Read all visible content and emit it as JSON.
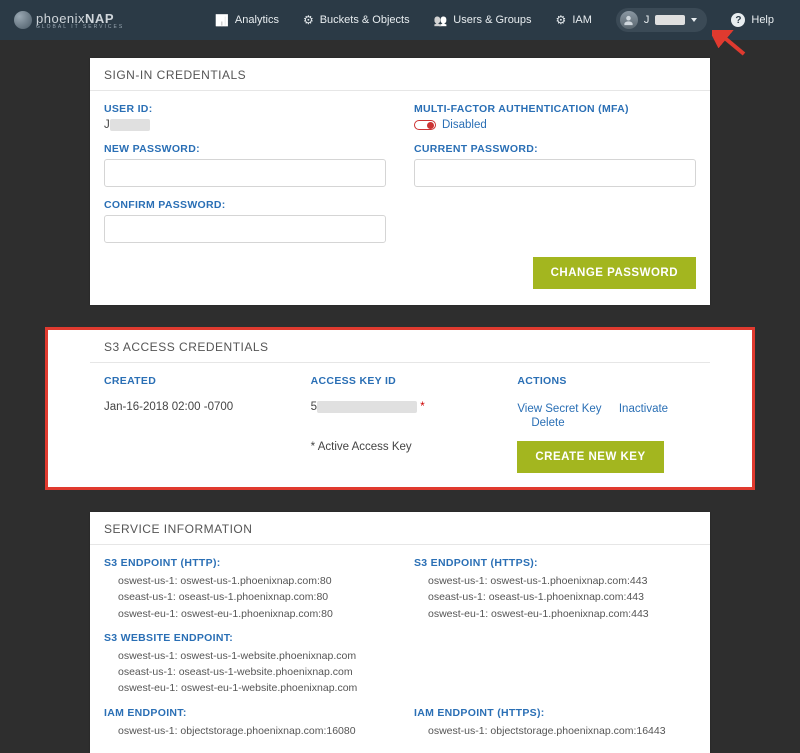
{
  "brand": {
    "name_light": "phoenix",
    "name_bold": "NAP",
    "tagline": "GLOBAL IT SERVICES"
  },
  "nav": {
    "analytics": "Analytics",
    "buckets": "Buckets & Objects",
    "users": "Users & Groups",
    "iam": "IAM",
    "help": "Help",
    "username_initial": "J"
  },
  "signin": {
    "title": "SIGN-IN CREDENTIALS",
    "user_id_label": "USER ID:",
    "user_id_value": "J",
    "mfa_label": "MULTI-FACTOR AUTHENTICATION (MFA)",
    "mfa_status": "Disabled",
    "new_pw_label": "NEW PASSWORD:",
    "current_pw_label": "CURRENT PASSWORD:",
    "confirm_pw_label": "CONFIRM PASSWORD:",
    "change_pw_btn": "CHANGE PASSWORD"
  },
  "s3creds": {
    "title": "S3 ACCESS CREDENTIALS",
    "col_created": "CREATED",
    "col_key": "ACCESS KEY ID",
    "col_actions": "ACTIONS",
    "created_value": "Jan-16-2018 02:00 -0700",
    "key_prefix": "5",
    "key_note": "* Active Access Key",
    "view_secret": "View Secret Key",
    "inactivate": "Inactivate",
    "delete": "Delete",
    "create_btn": "CREATE NEW KEY"
  },
  "svc": {
    "title": "SERVICE INFORMATION",
    "http_label": "S3 ENDPOINT (HTTP):",
    "https_label": "S3 ENDPOINT (HTTPS):",
    "website_label": "S3 WEBSITE ENDPOINT:",
    "iam_label": "IAM ENDPOINT:",
    "iam_https_label": "IAM ENDPOINT (HTTPS):",
    "http": [
      "oswest-us-1:  oswest-us-1.phoenixnap.com:80",
      "oseast-us-1:  oseast-us-1.phoenixnap.com:80",
      "oswest-eu-1:  oswest-eu-1.phoenixnap.com:80"
    ],
    "https": [
      "oswest-us-1:  oswest-us-1.phoenixnap.com:443",
      "oseast-us-1:  oseast-us-1.phoenixnap.com:443",
      "oswest-eu-1:  oswest-eu-1.phoenixnap.com:443"
    ],
    "website": [
      "oswest-us-1:  oswest-us-1-website.phoenixnap.com",
      "oseast-us-1:  oseast-us-1-website.phoenixnap.com",
      "oswest-eu-1:  oswest-eu-1-website.phoenixnap.com"
    ],
    "iam": "oswest-us-1:  objectstorage.phoenixnap.com:16080",
    "iam_https": "oswest-us-1:  objectstorage.phoenixnap.com:16443"
  }
}
